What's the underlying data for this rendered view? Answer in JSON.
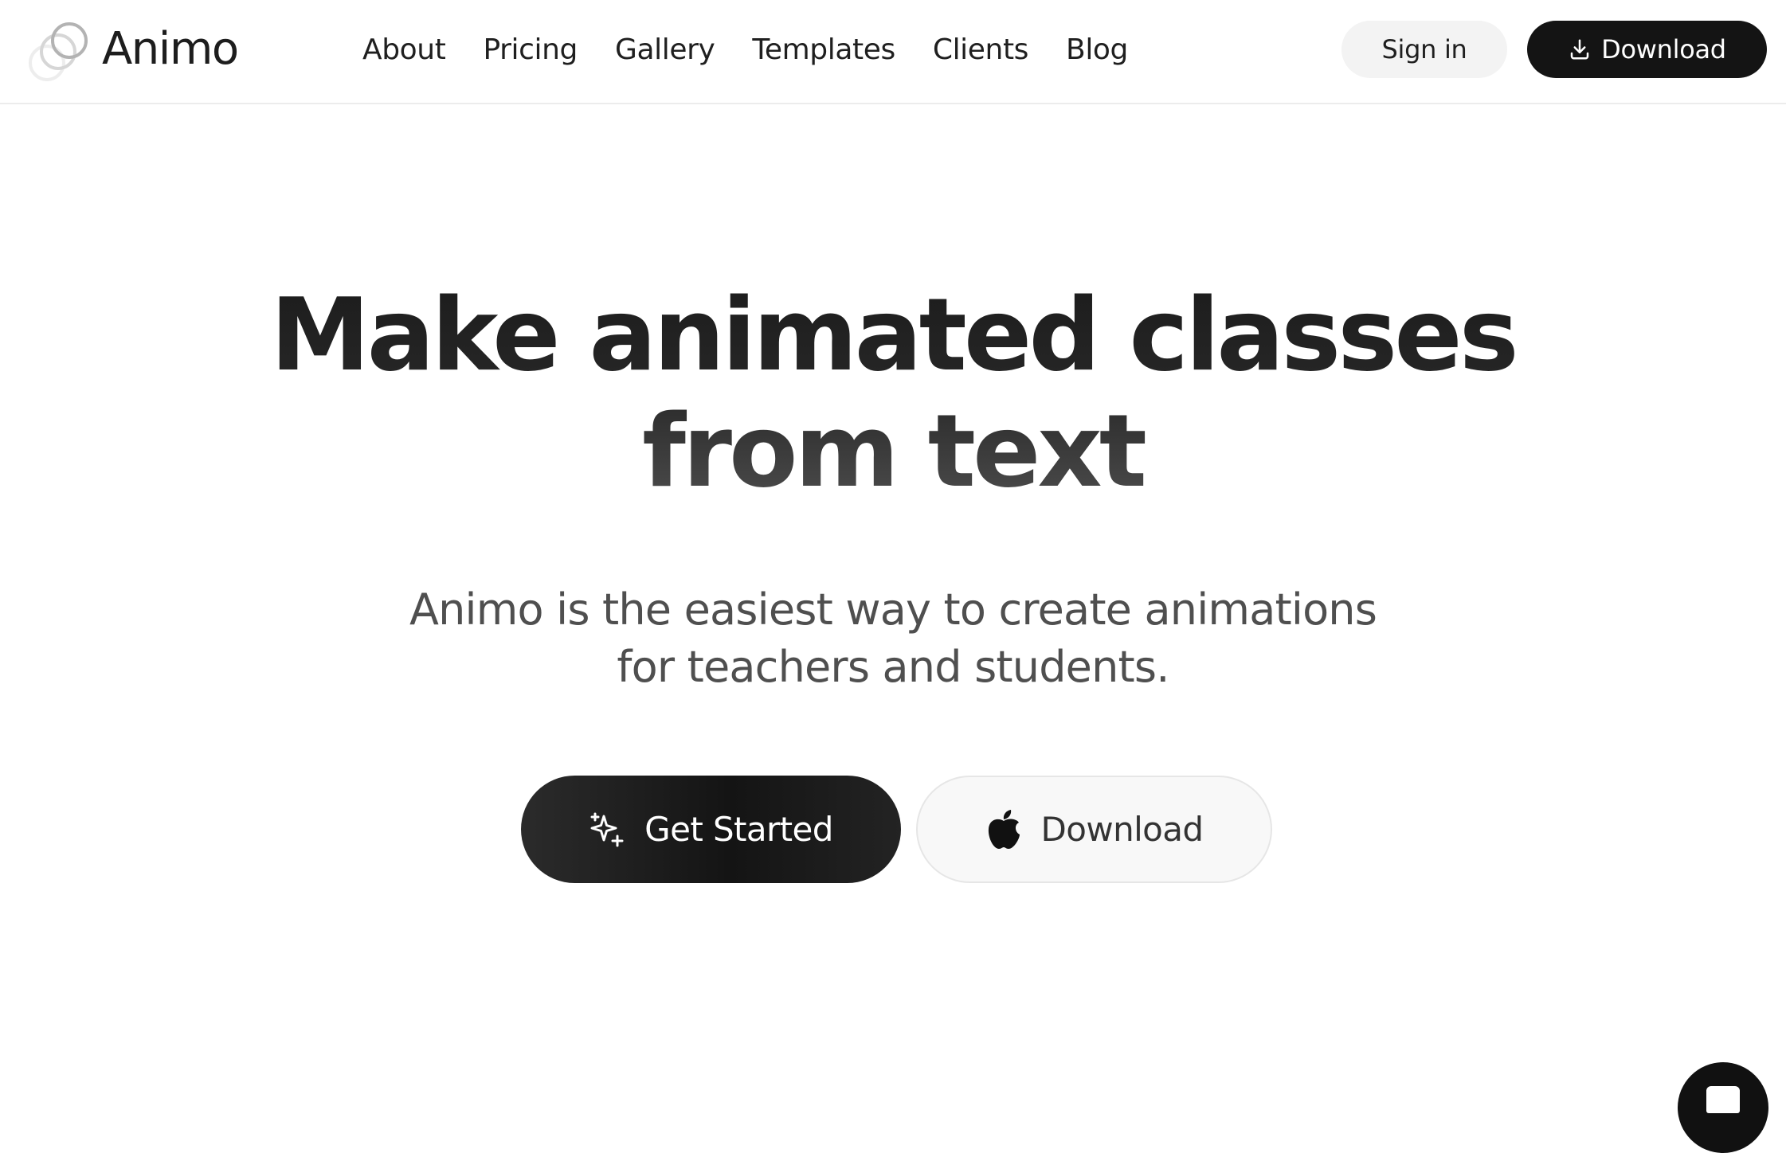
{
  "header": {
    "brand_name": "Animo",
    "logo_icon": "overlapping-rings-icon",
    "nav": [
      "About",
      "Pricing",
      "Gallery",
      "Templates",
      "Clients",
      "Blog"
    ],
    "sign_in_label": "Sign in",
    "download_label": "Download",
    "download_icon": "download-icon"
  },
  "hero": {
    "title_line1": "Make animated classes",
    "title_line2": "from text",
    "subtitle_line1": "Animo is the easiest way to create animations",
    "subtitle_line2": "for teachers and students.",
    "primary_cta_label": "Get Started",
    "primary_cta_icon": "sparkles-icon",
    "secondary_cta_label": "Download",
    "secondary_cta_icon": "apple-icon"
  },
  "chat_widget": {
    "icon": "chat-icon"
  },
  "colors": {
    "primary_dark": "#141414",
    "light_button": "#f3f3f3",
    "subtitle_text": "#4f4f4f",
    "divider": "#ececec"
  }
}
